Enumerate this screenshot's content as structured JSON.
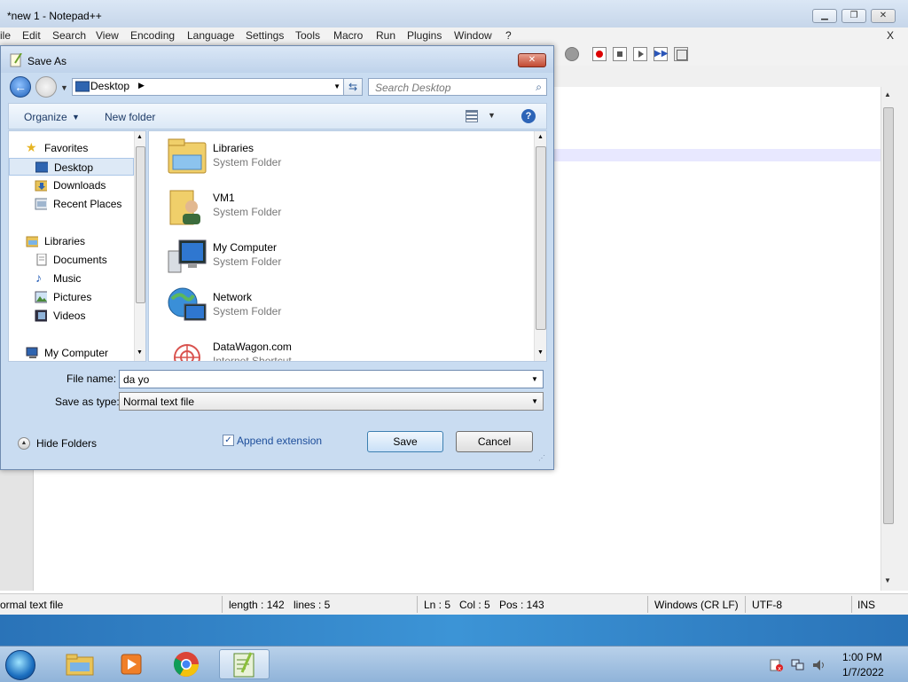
{
  "app": {
    "title": "*new 1 - Notepad++",
    "menu": [
      "ile",
      "Edit",
      "Search",
      "View",
      "Encoding",
      "Language",
      "Settings",
      "Tools",
      "Macro",
      "Run",
      "Plugins",
      "Window",
      "?"
    ],
    "menu_close": "X",
    "status": {
      "file_type": "ormal text file",
      "length": "length : 142",
      "lines": "lines : 5",
      "ln": "Ln : 5",
      "col": "Col : 5",
      "pos": "Pos : 143",
      "eol": "Windows (CR LF)",
      "encoding": "UTF-8",
      "mode": "INS"
    }
  },
  "dialog": {
    "title": "Save As",
    "address": "Desktop",
    "search_placeholder": "Search Desktop",
    "commands": {
      "organize": "Organize",
      "new_folder": "New folder"
    },
    "nav": [
      {
        "label": "Favorites",
        "icon": "star-icon"
      },
      {
        "label": "Desktop",
        "icon": "desktop-icon",
        "selected": true
      },
      {
        "label": "Downloads",
        "icon": "downloads-folder-icon"
      },
      {
        "label": "Recent Places",
        "icon": "recent-places-icon"
      },
      {
        "label": "Libraries",
        "icon": "libraries-icon"
      },
      {
        "label": "Documents",
        "icon": "documents-icon"
      },
      {
        "label": "Music",
        "icon": "music-icon"
      },
      {
        "label": "Pictures",
        "icon": "pictures-icon"
      },
      {
        "label": "Videos",
        "icon": "videos-icon"
      },
      {
        "label": "My Computer",
        "icon": "computer-icon"
      }
    ],
    "files": [
      {
        "name": "Libraries",
        "type": "System Folder",
        "icon": "libraries-folder-icon"
      },
      {
        "name": "VM1",
        "type": "System Folder",
        "icon": "user-folder-icon"
      },
      {
        "name": "My Computer",
        "type": "System Folder",
        "icon": "computer-icon"
      },
      {
        "name": "Network",
        "type": "System Folder",
        "icon": "network-icon"
      },
      {
        "name": "DataWagon.com",
        "type": "Internet Shortcut",
        "icon": "internet-shortcut-icon"
      }
    ],
    "file_name_label": "File name:",
    "file_name_value": "da yo",
    "save_type_label": "Save as type:",
    "save_type_value": "Normal text file",
    "hide_folders": "Hide Folders",
    "append_extension": "Append extension",
    "append_checked": true,
    "save": "Save",
    "cancel": "Cancel"
  },
  "taskbar": {
    "time": "1:00 PM",
    "date": "1/7/2022"
  }
}
